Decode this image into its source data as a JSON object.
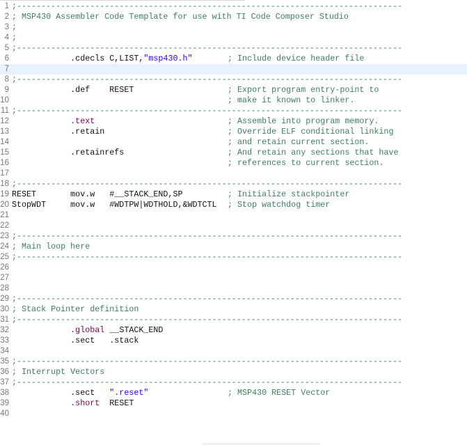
{
  "editor": {
    "current_line": 7,
    "lines": [
      {
        "n": "1",
        "code": [
          [
            ";-------------------------------------------------------------------------------",
            "comment"
          ]
        ]
      },
      {
        "n": "2",
        "code": [
          [
            "; MSP430 Assembler Code Template for use with TI Code Composer Studio",
            "comment"
          ]
        ]
      },
      {
        "n": "3",
        "code": [
          [
            ";",
            "comment"
          ]
        ]
      },
      {
        "n": "4",
        "code": [
          [
            ";",
            "comment"
          ]
        ]
      },
      {
        "n": "5",
        "code": [
          [
            ";-------------------------------------------------------------------------------",
            "comment"
          ]
        ]
      },
      {
        "n": "6",
        "code": [
          [
            "            .cdecls C,LIST,",
            "plain"
          ],
          [
            "\"msp430.h\"",
            "str"
          ]
        ],
        "comment": "; Include device header file"
      },
      {
        "n": "7",
        "code": []
      },
      {
        "n": "8",
        "code": [
          [
            ";-------------------------------------------------------------------------------",
            "comment"
          ]
        ]
      },
      {
        "n": "9",
        "code": [
          [
            "            .def    RESET",
            "plain"
          ]
        ],
        "comment": "; Export program entry-point to"
      },
      {
        "n": "10",
        "code": [],
        "comment": "; make it known to linker."
      },
      {
        "n": "11",
        "code": [
          [
            ";-------------------------------------------------------------------------------",
            "comment"
          ]
        ]
      },
      {
        "n": "12",
        "code": [
          [
            "            ",
            "plain"
          ],
          [
            ".text",
            "dir"
          ]
        ],
        "comment": "; Assemble into program memory."
      },
      {
        "n": "13",
        "code": [
          [
            "            .retain",
            "plain"
          ]
        ],
        "comment": "; Override ELF conditional linking"
      },
      {
        "n": "14",
        "code": [],
        "comment": "; and retain current section."
      },
      {
        "n": "15",
        "code": [
          [
            "            .retainrefs",
            "plain"
          ]
        ],
        "comment": "; And retain any sections that have"
      },
      {
        "n": "16",
        "code": [],
        "comment": "; references to current section."
      },
      {
        "n": "17",
        "code": []
      },
      {
        "n": "18",
        "code": [
          [
            ";-------------------------------------------------------------------------------",
            "comment"
          ]
        ]
      },
      {
        "n": "19",
        "code": [
          [
            "RESET       mov.w   #__STACK_END,SP",
            "plain"
          ]
        ],
        "comment": "; Initialize stackpointer"
      },
      {
        "n": "20",
        "code": [
          [
            "StopWDT     mov.w   #WDTPW|WDTHOLD,&WDTCTL",
            "plain"
          ]
        ],
        "comment": "; Stop watchdog timer"
      },
      {
        "n": "21",
        "code": []
      },
      {
        "n": "22",
        "code": []
      },
      {
        "n": "23",
        "code": [
          [
            ";-------------------------------------------------------------------------------",
            "comment"
          ]
        ]
      },
      {
        "n": "24",
        "code": [
          [
            "; Main loop here",
            "comment"
          ]
        ]
      },
      {
        "n": "25",
        "code": [
          [
            ";-------------------------------------------------------------------------------",
            "comment"
          ]
        ]
      },
      {
        "n": "26",
        "code": []
      },
      {
        "n": "27",
        "code": []
      },
      {
        "n": "28",
        "code": []
      },
      {
        "n": "29",
        "code": [
          [
            ";-------------------------------------------------------------------------------",
            "comment"
          ]
        ]
      },
      {
        "n": "30",
        "code": [
          [
            "; Stack Pointer definition",
            "comment"
          ]
        ]
      },
      {
        "n": "31",
        "code": [
          [
            ";-------------------------------------------------------------------------------",
            "comment"
          ]
        ]
      },
      {
        "n": "32",
        "code": [
          [
            "            ",
            "plain"
          ],
          [
            ".global",
            "dir"
          ],
          [
            " __STACK_END",
            "plain"
          ]
        ]
      },
      {
        "n": "33",
        "code": [
          [
            "            .sect   .stack",
            "plain"
          ]
        ]
      },
      {
        "n": "34",
        "code": []
      },
      {
        "n": "35",
        "code": [
          [
            ";-------------------------------------------------------------------------------",
            "comment"
          ]
        ]
      },
      {
        "n": "36",
        "code": [
          [
            "; Interrupt Vectors",
            "comment"
          ]
        ]
      },
      {
        "n": "37",
        "code": [
          [
            ";-------------------------------------------------------------------------------",
            "comment"
          ]
        ]
      },
      {
        "n": "38",
        "code": [
          [
            "            .sect   ",
            "plain"
          ],
          [
            "\".reset\"",
            "str"
          ]
        ],
        "comment": "; MSP430 RESET Vector"
      },
      {
        "n": "39",
        "code": [
          [
            "            ",
            "plain"
          ],
          [
            ".short",
            "dir"
          ],
          [
            "  RESET",
            "plain"
          ]
        ]
      },
      {
        "n": "40",
        "code": []
      }
    ]
  }
}
